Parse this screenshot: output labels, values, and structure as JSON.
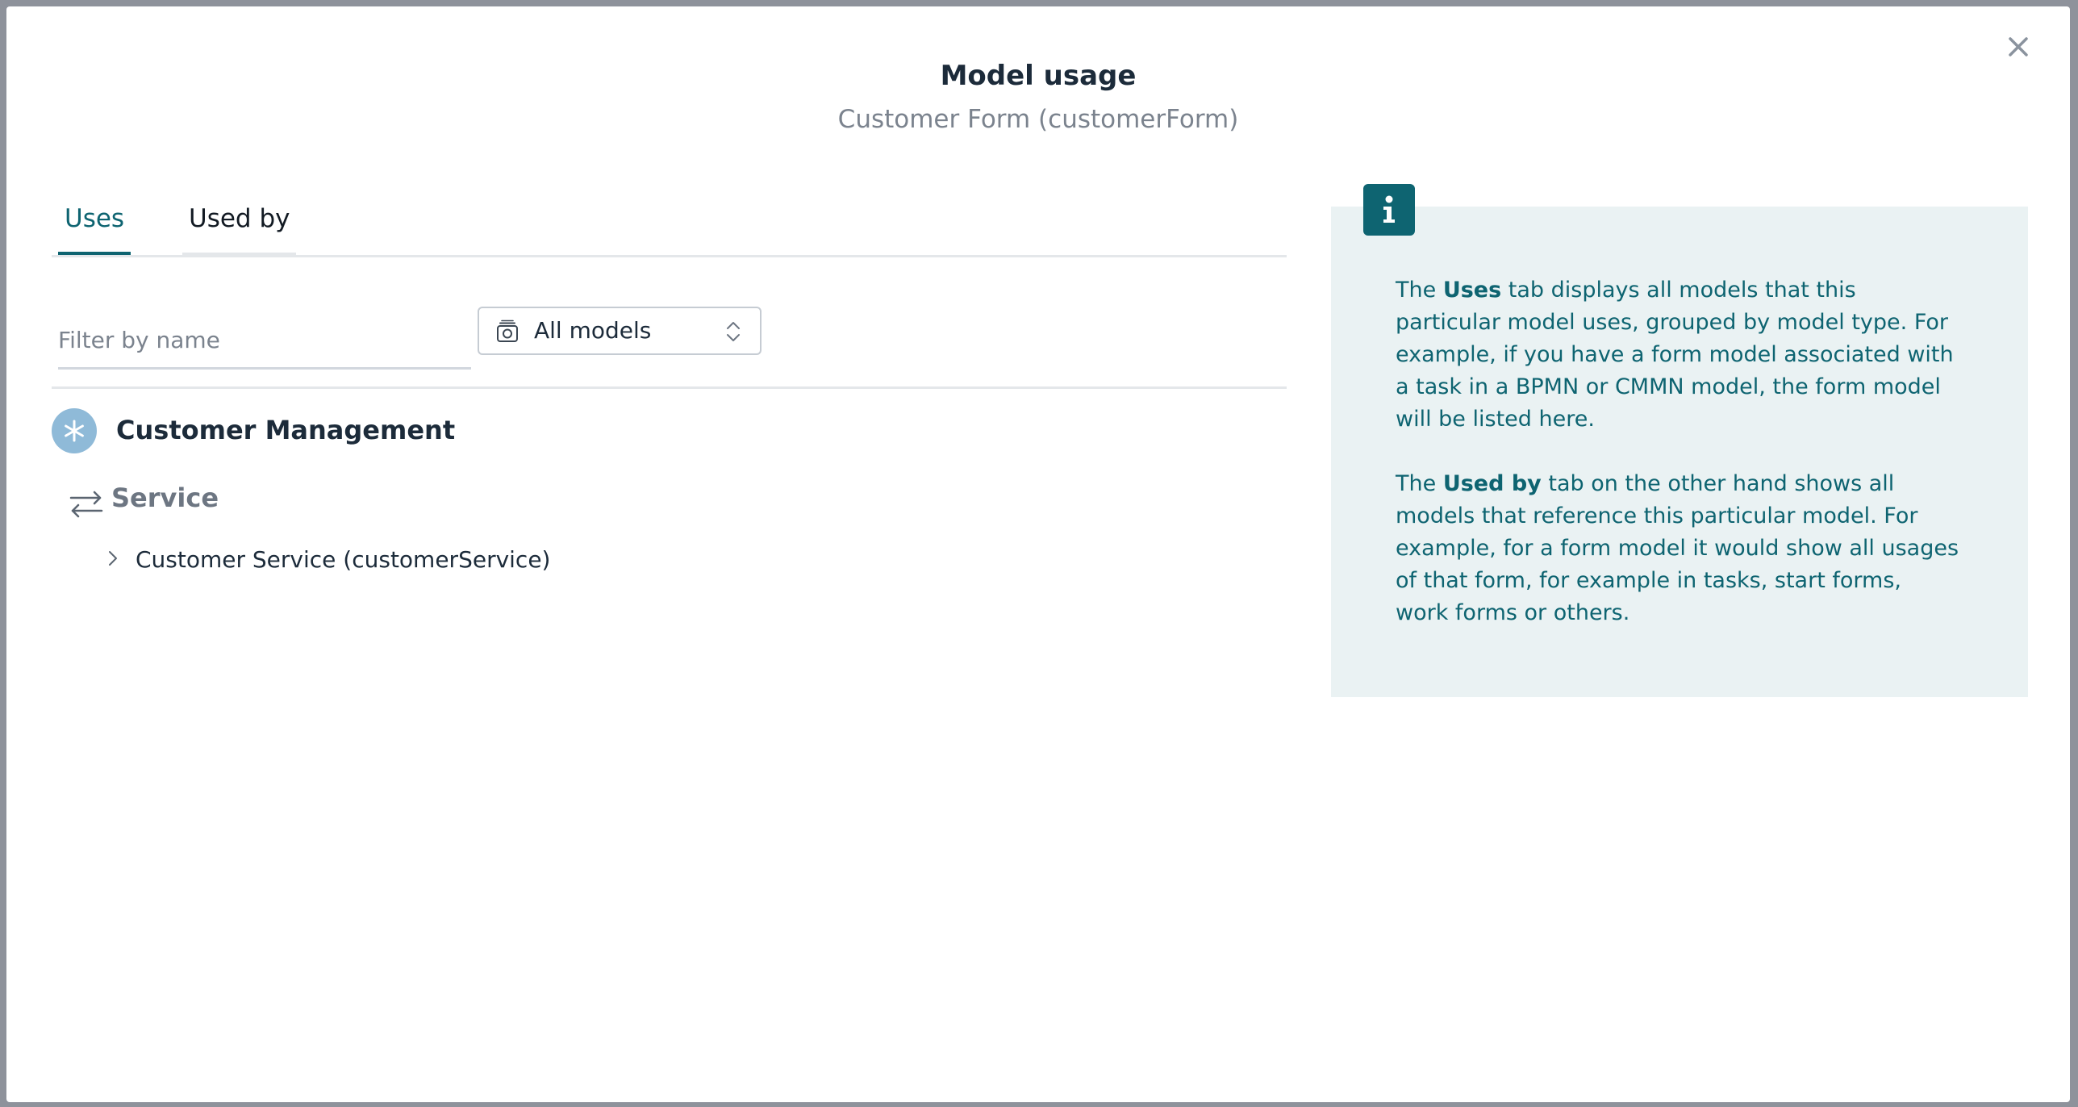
{
  "modal": {
    "title": "Model usage",
    "subtitle": "Customer Form (customerForm)",
    "close_icon": "close-icon"
  },
  "tabs": [
    {
      "label": "Uses",
      "active": true
    },
    {
      "label": "Used by",
      "active": false
    }
  ],
  "filter": {
    "placeholder": "Filter by name",
    "value": ""
  },
  "model_select": {
    "icon": "model-stack-icon",
    "selected": "All models"
  },
  "results": {
    "group": {
      "icon": "app-asterisk-icon",
      "title": "Customer Management"
    },
    "type": {
      "icon": "service-arrows-icon",
      "title": "Service"
    },
    "items": [
      {
        "label": "Customer Service (customerService)"
      }
    ]
  },
  "info": {
    "icon": "info-icon",
    "p1_lead": "The ",
    "p1_bold": "Uses",
    "p1_rest": " tab displays all models that this particular model uses, grouped by model type. For example, if you have a form model associated with a task in a BPMN or CMMN model, the form model will be listed here.",
    "p2_lead": "The ",
    "p2_bold": "Used by",
    "p2_rest": " tab on the other hand shows all models that reference this particular model. For example, for a form model it would show all usages of that form, for example in tasks, start forms, work forms or others."
  },
  "colors": {
    "accent": "#0e6471",
    "info_bg": "#eaf2f3",
    "group_icon_bg": "#8fbad8",
    "backdrop": "#8e929b"
  }
}
